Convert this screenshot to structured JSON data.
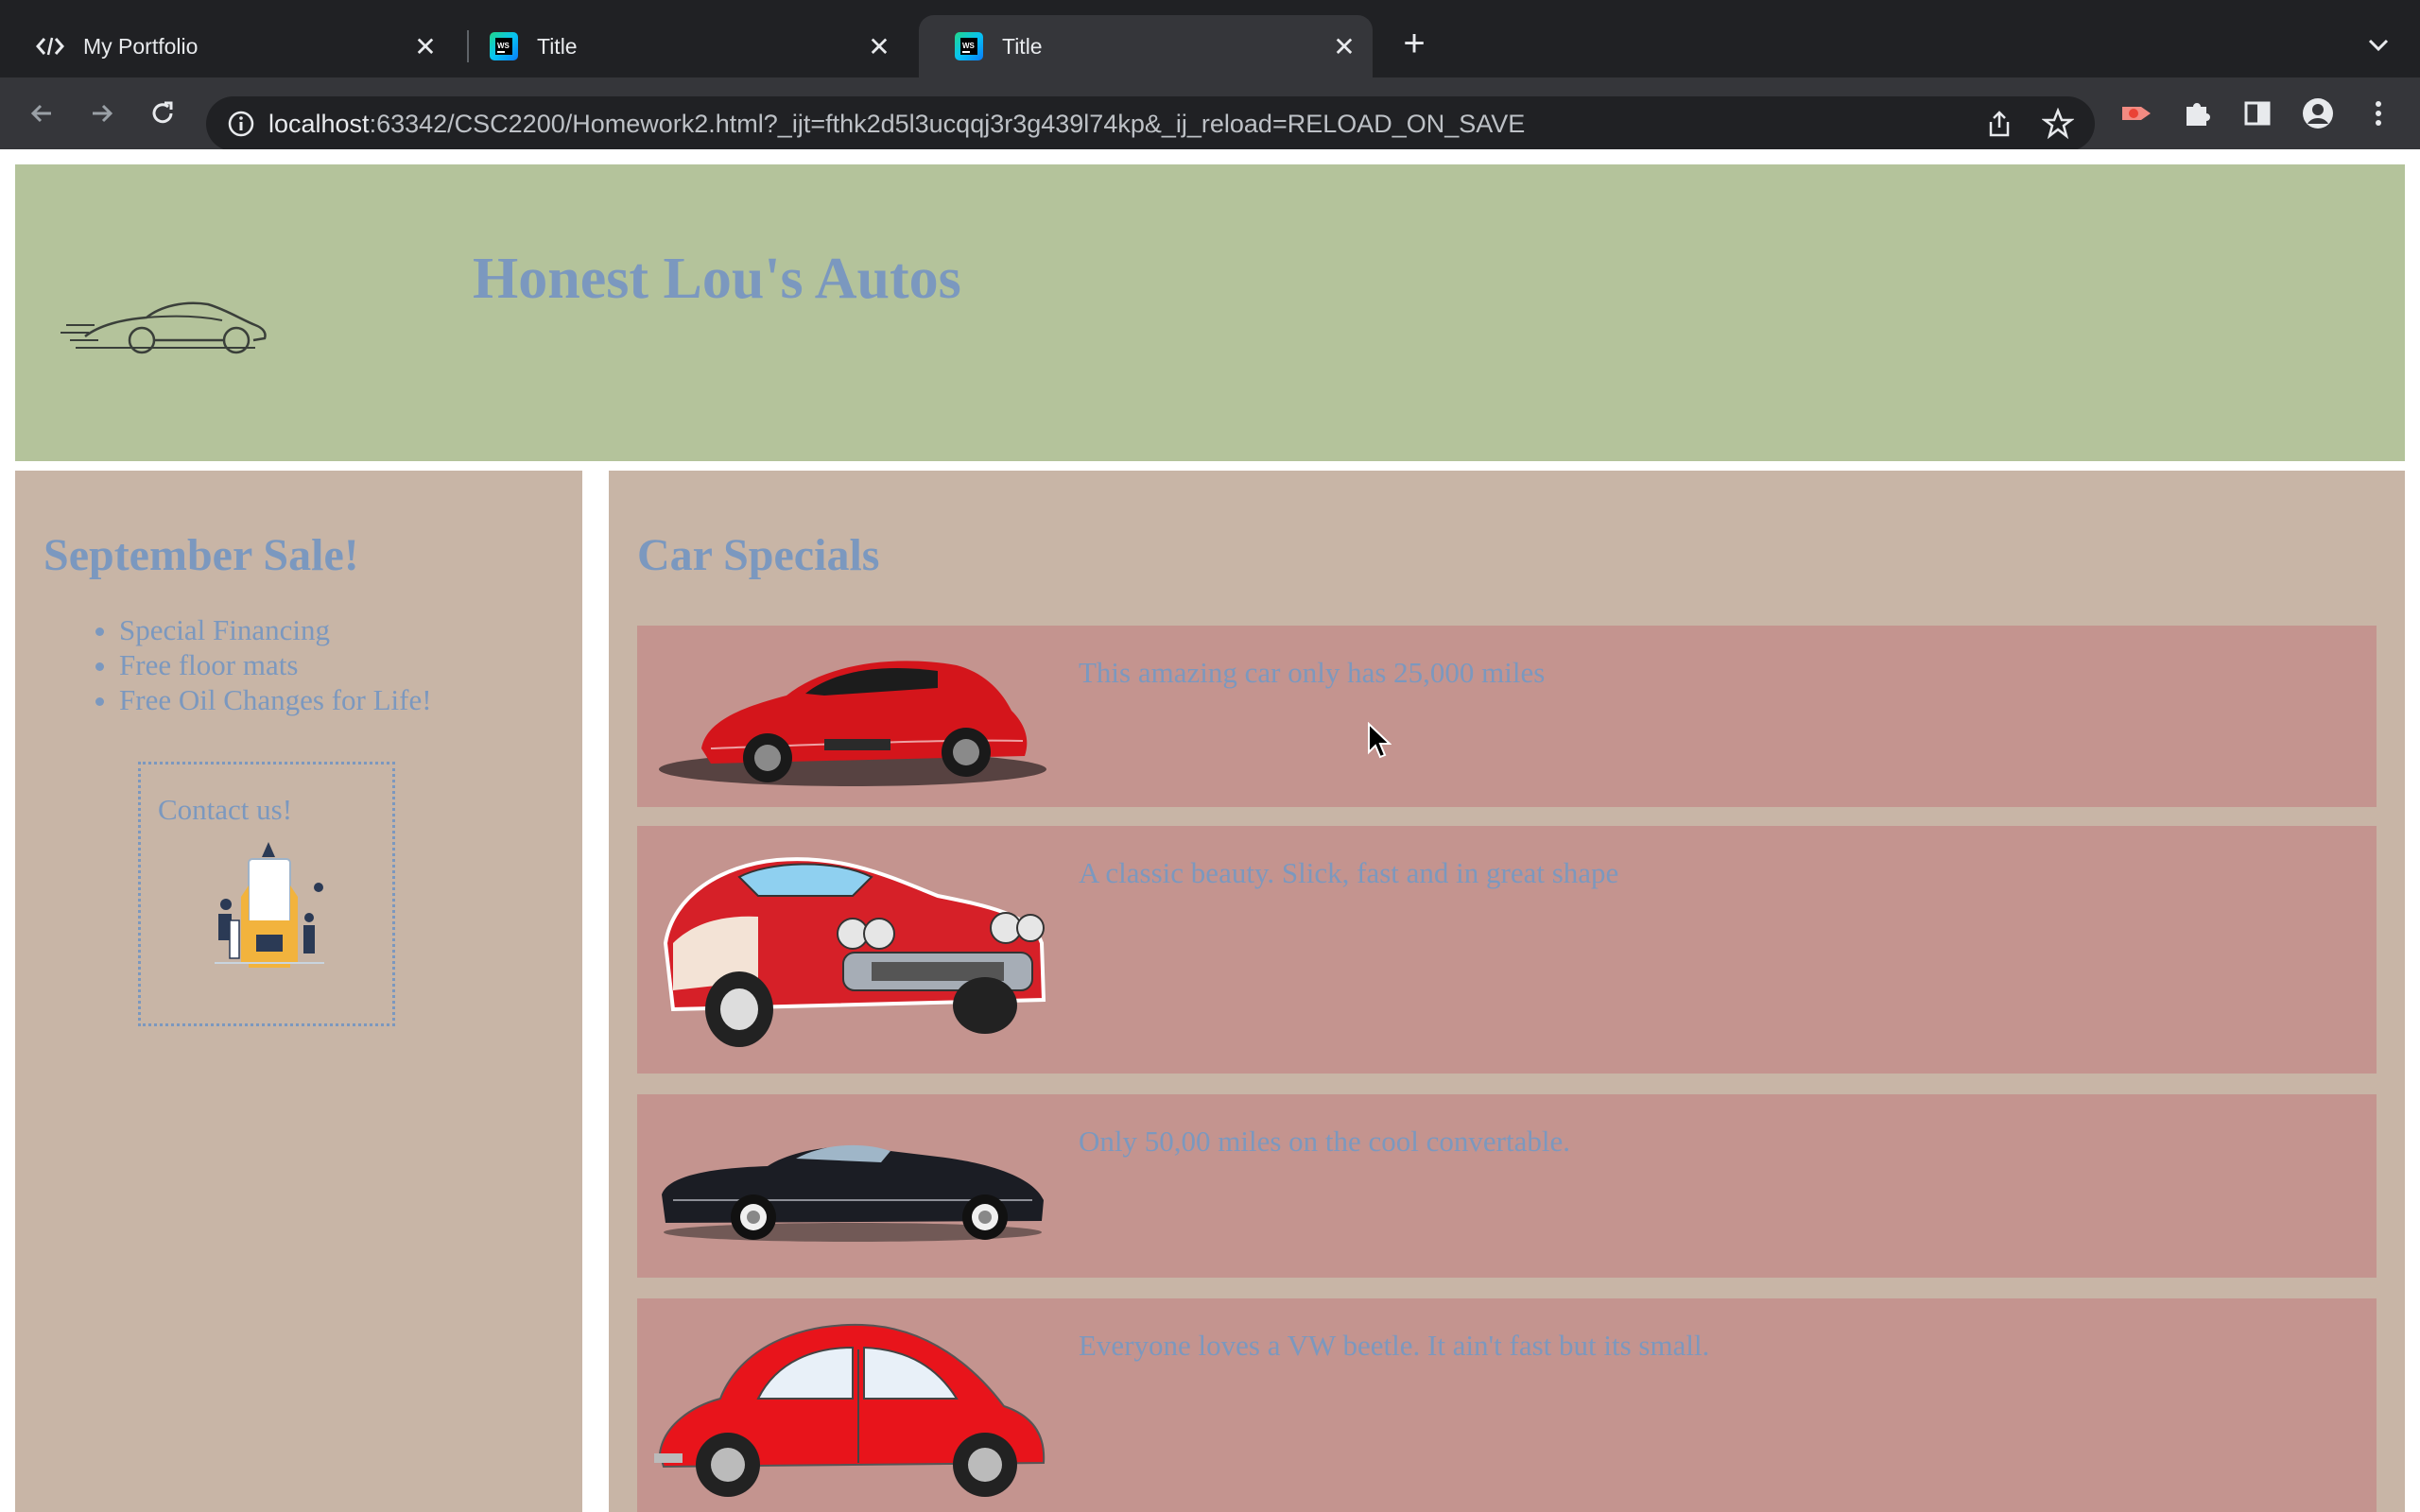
{
  "browser": {
    "tabs": [
      {
        "title": "My Portfolio",
        "favicon": "code-icon",
        "active": false
      },
      {
        "title": "Title",
        "favicon": "webstorm-icon",
        "active": false
      },
      {
        "title": "Title",
        "favicon": "webstorm-icon",
        "active": true
      }
    ],
    "url_host": "localhost",
    "url_rest": ":63342/CSC2200/Homework2.html?_ijt=fthk2d5l3ucqqj3r3g439l74kp&_ij_reload=RELOAD_ON_SAVE"
  },
  "header": {
    "title": "Honest Lou's Autos",
    "logo": "sports-car-icon"
  },
  "sidebar": {
    "heading": "September Sale!",
    "items": [
      "Special Financing",
      "Free floor mats",
      "Free Oil Changes for Life!"
    ],
    "contact_label": "Contact us!"
  },
  "main": {
    "heading": "Car Specials",
    "specials": [
      {
        "image": "red-sports-car-icon",
        "description": "This amazing car only has 25,000 miles"
      },
      {
        "image": "red-classic-convertible-icon",
        "description": "A classic beauty. Slick, fast and in great shape"
      },
      {
        "image": "black-vintage-convertible-icon",
        "description": "Only 50,00 miles on the cool convertable."
      },
      {
        "image": "red-vw-beetle-icon",
        "description": "Everyone loves a VW beetle. It ain't fast but its small."
      }
    ]
  },
  "colors": {
    "header_bg": "#b4c39b",
    "panel_bg": "#c8b5a6",
    "special_bg": "#c4948f",
    "text": "#7b98bf"
  }
}
